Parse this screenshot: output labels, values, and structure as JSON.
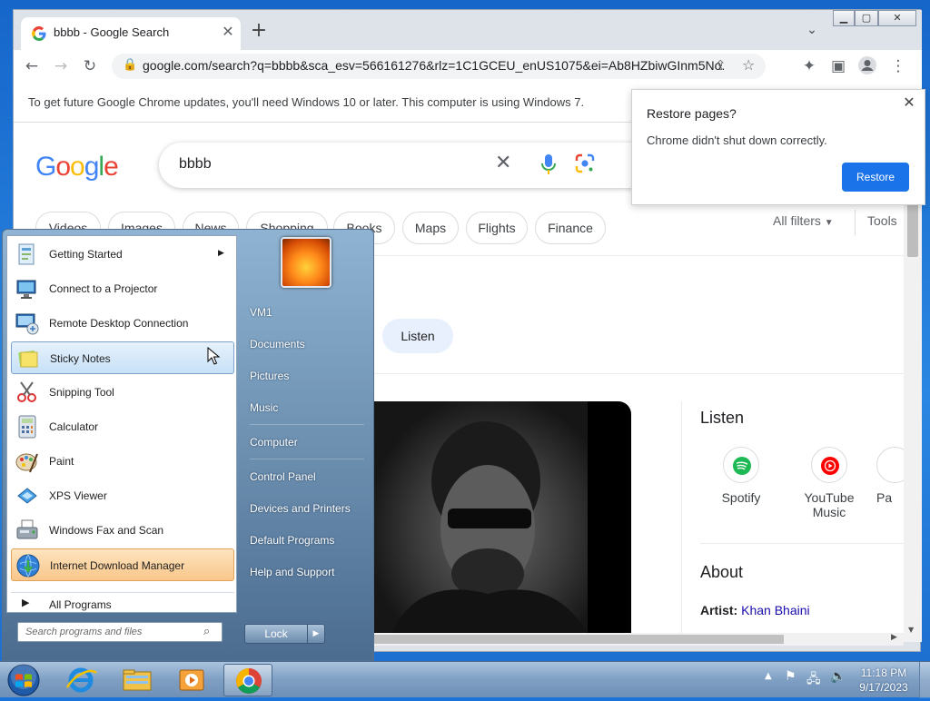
{
  "browser": {
    "tab_title": "bbbb - Google Search",
    "url": "google.com/search?q=bbbb&sca_esv=566161276&rlz=1C1GCEU_enUS1075&ei=Ab8HZbiwGInm5No...",
    "infobar": "To get future Google Chrome updates, you'll need Windows 10 or later. This computer is using Windows 7.",
    "tab_close": "✕",
    "newtab": "+"
  },
  "restore_popup": {
    "title": "Restore pages?",
    "description": "Chrome didn't shut down correctly.",
    "button": "Restore"
  },
  "google": {
    "query": "bbbb",
    "chips": [
      "Videos",
      "Images",
      "News",
      "Shopping",
      "Books",
      "Maps",
      "Flights",
      "Finance"
    ],
    "all_filters": "All filters",
    "tools": "Tools",
    "listen_chip": "Listen",
    "panel": {
      "listen_heading": "Listen",
      "services": [
        {
          "name": "Spotify",
          "color": "#1db954"
        },
        {
          "name": "YouTube Music",
          "color": "#ff0000"
        },
        {
          "name": "Pa",
          "color": "#999999"
        }
      ],
      "about_heading": "About",
      "artist_label": "Artist:",
      "artist_value": "Khan Bhaini"
    }
  },
  "start_menu": {
    "items": [
      {
        "label": "Getting Started",
        "icon": "getting-started-icon",
        "submenu": true
      },
      {
        "label": "Connect to a Projector",
        "icon": "projector-icon"
      },
      {
        "label": "Remote Desktop Connection",
        "icon": "remote-desktop-icon"
      },
      {
        "label": "Sticky Notes",
        "icon": "sticky-notes-icon",
        "hovered": true
      },
      {
        "label": "Snipping Tool",
        "icon": "snipping-tool-icon"
      },
      {
        "label": "Calculator",
        "icon": "calculator-icon"
      },
      {
        "label": "Paint",
        "icon": "paint-icon"
      },
      {
        "label": "XPS Viewer",
        "icon": "xps-viewer-icon"
      },
      {
        "label": "Windows Fax and Scan",
        "icon": "fax-scan-icon"
      },
      {
        "label": "Internet Download Manager",
        "icon": "idm-icon",
        "highlighted": true
      }
    ],
    "all_programs": "All Programs",
    "search_placeholder": "Search programs and files",
    "right_links": [
      "VM1",
      "Documents",
      "Pictures",
      "Music",
      "Computer",
      "Control Panel",
      "Devices and Printers",
      "Default Programs",
      "Help and Support"
    ],
    "lock": "Lock"
  },
  "taskbar": {
    "time": "11:18 PM",
    "date": "9/17/2023"
  }
}
